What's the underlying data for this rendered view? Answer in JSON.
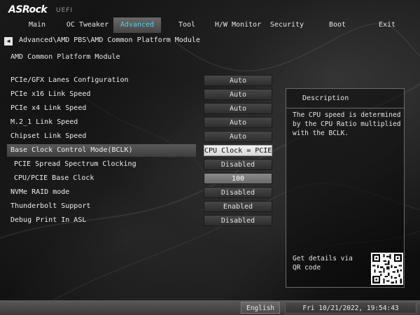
{
  "brand": {
    "logo": "ASRock",
    "sub": "UEFI"
  },
  "tabs": [
    {
      "label": "Main"
    },
    {
      "label": "OC Tweaker"
    },
    {
      "label": "Advanced"
    },
    {
      "label": "Tool"
    },
    {
      "label": "H/W Monitor"
    },
    {
      "label": "Security"
    },
    {
      "label": "Boot"
    },
    {
      "label": "Exit"
    }
  ],
  "active_tab": "Advanced",
  "breadcrumb": "Advanced\\AMD PBS\\AMD Common Platform Module",
  "section_title": "AMD Common Platform Module",
  "settings": [
    {
      "label": "PCIe/GFX Lanes Configuration",
      "value": "Auto"
    },
    {
      "label": "PCIe x16 Link Speed",
      "value": "Auto"
    },
    {
      "label": "PCIe x4 Link Speed",
      "value": "Auto"
    },
    {
      "label": "M.2_1 Link Speed",
      "value": "Auto"
    },
    {
      "label": "Chipset Link Speed",
      "value": "Auto"
    },
    {
      "label": "Base Clock Control Mode(BCLK)",
      "value": "CPU Clock = PCIE ..."
    },
    {
      "label": "PCIE Spread Spectrum Clocking",
      "value": "Disabled"
    },
    {
      "label": "CPU/PCIE Base Clock",
      "value": "100"
    },
    {
      "label": "NVMe RAID mode",
      "value": "Disabled"
    },
    {
      "label": "Thunderbolt Support",
      "value": "Enabled"
    },
    {
      "label": "Debug Print In ASL",
      "value": "Disabled"
    }
  ],
  "description": {
    "title": "Description",
    "text": "The CPU speed is determined by the CPU Ratio multiplied with the BCLK.",
    "qr_text": "Get details via QR code"
  },
  "footer": {
    "language": "English",
    "datetime": "Fri 10/21/2022, 19:54:43"
  },
  "colors": {
    "active_tab_text": "#4fd0ea",
    "selected_value_bg": "#e6e6e6",
    "footer_bg": "#4a4a4a"
  }
}
